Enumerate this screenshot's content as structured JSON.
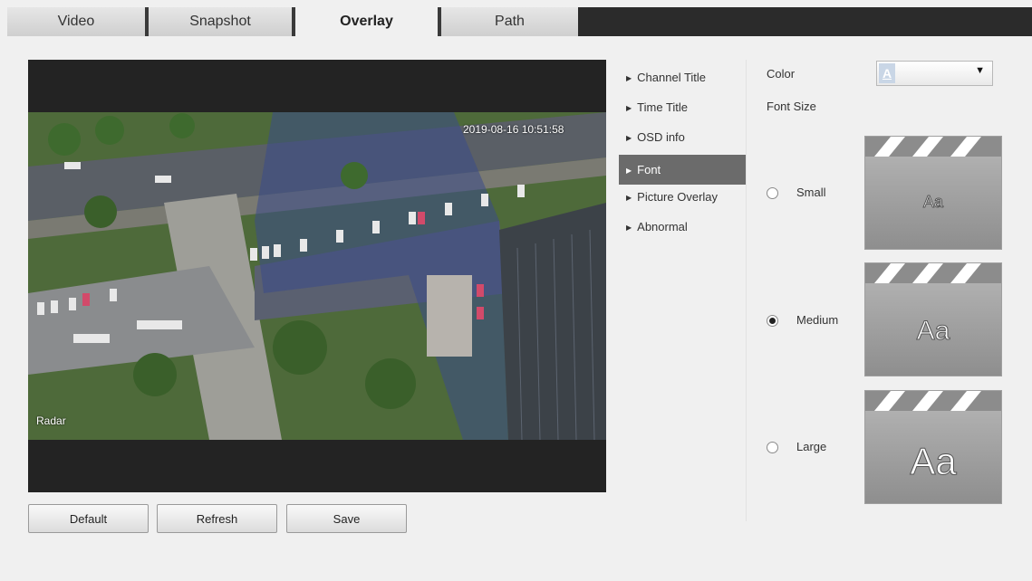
{
  "tabs": [
    {
      "label": "Video",
      "active": false
    },
    {
      "label": "Snapshot",
      "active": false
    },
    {
      "label": "Overlay",
      "active": true
    },
    {
      "label": "Path",
      "active": false
    }
  ],
  "video": {
    "time_title": "2019-08-16 10:51:58",
    "channel_title": "Radar"
  },
  "buttons": {
    "default": "Default",
    "refresh": "Refresh",
    "save": "Save"
  },
  "menu": {
    "items": [
      {
        "label": "Channel Title",
        "active": false
      },
      {
        "label": "Time Title",
        "active": false
      },
      {
        "label": "OSD info",
        "active": false
      },
      {
        "label": "Font",
        "active": true
      },
      {
        "label": "Picture Overlay",
        "active": false
      },
      {
        "label": "Abnormal",
        "active": false
      }
    ]
  },
  "font_panel": {
    "color_label": "Color",
    "color_value_glyph": "A",
    "font_size_label": "Font Size",
    "sizes": [
      {
        "label": "Small",
        "selected": false,
        "preview": "Aa"
      },
      {
        "label": "Medium",
        "selected": true,
        "preview": "Aa"
      },
      {
        "label": "Large",
        "selected": false,
        "preview": "Aa"
      }
    ]
  },
  "colors": {
    "active_menu_bg": "#6b6b6b",
    "topbar_bg": "#2b2b2b",
    "page_bg": "#f0f0f0"
  }
}
